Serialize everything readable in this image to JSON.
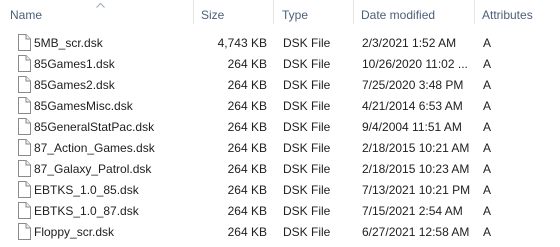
{
  "columns": {
    "name": "Name",
    "size": "Size",
    "type": "Type",
    "date_modified": "Date modified",
    "attributes": "Attributes"
  },
  "files": [
    {
      "name": "5MB_scr.dsk",
      "size": "4,743 KB",
      "type": "DSK File",
      "date": "2/3/2021 1:52 AM",
      "attr": "A"
    },
    {
      "name": "85Games1.dsk",
      "size": "264 KB",
      "type": "DSK File",
      "date": "10/26/2020 11:02 ...",
      "attr": "A"
    },
    {
      "name": "85Games2.dsk",
      "size": "264 KB",
      "type": "DSK File",
      "date": "7/25/2020 3:48 PM",
      "attr": "A"
    },
    {
      "name": "85GamesMisc.dsk",
      "size": "264 KB",
      "type": "DSK File",
      "date": "4/21/2014 6:53 AM",
      "attr": "A"
    },
    {
      "name": "85GeneralStatPac.dsk",
      "size": "264 KB",
      "type": "DSK File",
      "date": "9/4/2004 11:51 AM",
      "attr": "A"
    },
    {
      "name": "87_Action_Games.dsk",
      "size": "264 KB",
      "type": "DSK File",
      "date": "2/18/2015 10:21 AM",
      "attr": "A"
    },
    {
      "name": "87_Galaxy_Patrol.dsk",
      "size": "264 KB",
      "type": "DSK File",
      "date": "2/18/2015 10:23 AM",
      "attr": "A"
    },
    {
      "name": "EBTKS_1.0_85.dsk",
      "size": "264 KB",
      "type": "DSK File",
      "date": "7/13/2021 10:21 PM",
      "attr": "A"
    },
    {
      "name": "EBTKS_1.0_87.dsk",
      "size": "264 KB",
      "type": "DSK File",
      "date": "7/15/2021 2:54 AM",
      "attr": "A"
    },
    {
      "name": "Floppy_scr.dsk",
      "size": "264 KB",
      "type": "DSK File",
      "date": "6/27/2021 12:58 AM",
      "attr": "A"
    }
  ],
  "icons": {
    "file": "generic-file-icon",
    "sort": "sort-ascending-icon"
  }
}
